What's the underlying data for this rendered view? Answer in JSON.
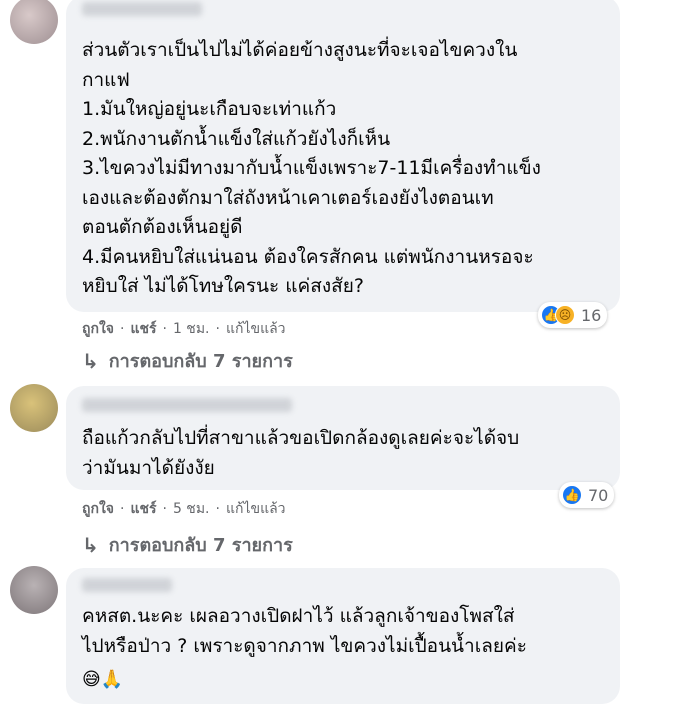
{
  "comments": [
    {
      "author": "",
      "lines": [
        "ส่วนตัวเราเป็นไปไม่ได้ค่อยข้างสูงนะที่จะเจอไขควงใน",
        "กาแฟ",
        "1.มันใหญ่อยู่นะเกือบจะเท่าแก้ว",
        "2.พนักงานตักน้ำแข็งใส่แก้วยังไงก็เห็น",
        "3.ไขควงไม่มีทางมากับน้ำแข็งเพราะ7-11มีเครื่องทำแข็ง",
        "เองและต้องตักมาใส่ถังหน้าเคาเตอร์เองยังไงตอนเท",
        "ตอนตักต้องเห็นอยู่ดี",
        "4.มีคนหยิบใส่แน่นอน ต้องใครสักคน แต่พนักงานหรอจะ",
        "หยิบใส่ ไม่ได้โทษใครนะ แค่สงสัย?"
      ],
      "reaction_count": "16",
      "actions": {
        "like": "ถูกใจ",
        "share": "แชร์",
        "time": "1 ชม.",
        "edited": "แก้ไขแล้ว"
      },
      "replies_label": "การตอบกลับ 7 รายการ"
    },
    {
      "author": "",
      "lines": [
        "ถือแก้วกลับไปที่สาขาแล้วขอเปิดกล้องดูเลยค่ะจะได้จบ",
        "ว่ามันมาได้ยังงัย"
      ],
      "reaction_count": "70",
      "actions": {
        "like": "ถูกใจ",
        "share": "แชร์",
        "time": "5 ชม.",
        "edited": "แก้ไขแล้ว"
      },
      "replies_label": "การตอบกลับ 7 รายการ"
    },
    {
      "author": "",
      "lines": [
        "คหสต.นะคะ เผลอวางเปิดฝาไว้ แล้วลูกเจ้าของโพสใส่",
        "ไปหรือป่าว ? เพราะดูจากภาพ ไขควงไม่เปื้อนน้ำเลยค่ะ"
      ],
      "emoji": "😅🙏"
    }
  ],
  "separator": "·",
  "colors": {
    "bubble": "#f0f2f5",
    "secondary_text": "#65676b",
    "like_blue": "#1877f2"
  }
}
